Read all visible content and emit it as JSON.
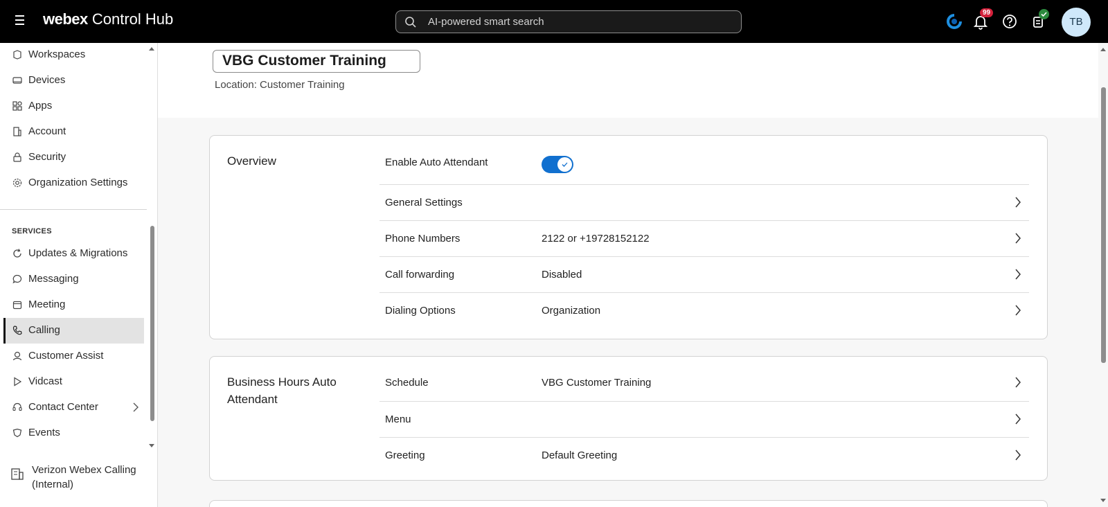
{
  "topbar": {
    "brand_bold": "webex",
    "brand_rest": " Control Hub",
    "search_placeholder": "AI-powered smart search",
    "notification_count": "99",
    "avatar_initials": "TB"
  },
  "sidebar": {
    "items_top": [
      {
        "label": "Workspaces",
        "icon": "workspaces-icon"
      },
      {
        "label": "Devices",
        "icon": "devices-icon"
      },
      {
        "label": "Apps",
        "icon": "apps-icon"
      },
      {
        "label": "Account",
        "icon": "account-icon"
      },
      {
        "label": "Security",
        "icon": "lock-icon"
      },
      {
        "label": "Organization Settings",
        "icon": "gear-icon"
      }
    ],
    "services_title": "SERVICES",
    "items_services": [
      {
        "label": "Updates & Migrations",
        "icon": "refresh-icon"
      },
      {
        "label": "Messaging",
        "icon": "chat-icon"
      },
      {
        "label": "Meeting",
        "icon": "calendar-icon"
      },
      {
        "label": "Calling",
        "icon": "phone-icon",
        "active": true
      },
      {
        "label": "Customer Assist",
        "icon": "customer-assist-icon"
      },
      {
        "label": "Vidcast",
        "icon": "play-icon"
      },
      {
        "label": "Contact Center",
        "icon": "headset-icon"
      },
      {
        "label": "Events",
        "icon": "events-icon"
      }
    ],
    "org_name": "Verizon Webex Calling (Internal)"
  },
  "main": {
    "title": "VBG Customer Training",
    "location": "Location: Customer Training",
    "overview": {
      "title": "Overview",
      "enable_label": "Enable Auto Attendant",
      "enable_state": true,
      "rows": [
        {
          "label": "General Settings",
          "value": ""
        },
        {
          "label": "Phone Numbers",
          "value": "2122 or +19728152122"
        },
        {
          "label": "Call forwarding",
          "value": "Disabled"
        },
        {
          "label": "Dialing Options",
          "value": "Organization"
        }
      ]
    },
    "business_hours": {
      "title": "Business Hours Auto Attendant",
      "rows": [
        {
          "label": "Schedule",
          "value": "VBG Customer Training"
        },
        {
          "label": "Menu",
          "value": ""
        },
        {
          "label": "Greeting",
          "value": "Default Greeting"
        }
      ]
    }
  },
  "colors": {
    "accent": "#1170cf",
    "topbar_bg": "#000000",
    "badge": "#d4213b",
    "active_nav_bg": "#e3e3e3"
  }
}
